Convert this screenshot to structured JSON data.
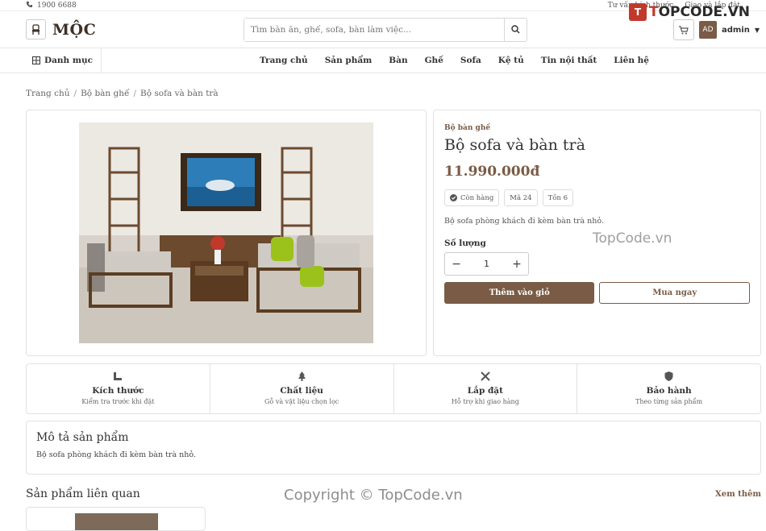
{
  "topbar": {
    "phone": "1900 6688",
    "links": [
      "Tư vấn kích thước",
      "Giao và lắp đặt"
    ]
  },
  "brand": {
    "name": "MỘC",
    "overlay_logo": "TOPCODE.VN"
  },
  "search": {
    "placeholder": "Tìm bàn ăn, ghế, sofa, bàn làm việc..."
  },
  "user": {
    "initials": "AD",
    "name": "admin"
  },
  "nav": {
    "category_label": "Danh mục",
    "items": [
      "Trang chủ",
      "Sản phẩm",
      "Bàn",
      "Ghế",
      "Sofa",
      "Kệ tủ",
      "Tin nội thất",
      "Liên hệ"
    ]
  },
  "breadcrumb": [
    "Trang chủ",
    "Bộ bàn ghế",
    "Bộ sofa và bàn trà"
  ],
  "product": {
    "category": "Bộ bàn ghế",
    "title": "Bộ sofa và bàn trà",
    "price": "11.990.000đ",
    "badges": [
      "Còn hàng",
      "Mã 24",
      "Tồn 6"
    ],
    "short_desc": "Bộ sofa phòng khách đi kèm bàn trà nhỏ.",
    "qty_label": "Số lượng",
    "qty": "1",
    "add_to_cart": "Thêm vào giỏ",
    "buy_now": "Mua ngay"
  },
  "features": [
    {
      "title": "Kích thước",
      "sub": "Kiểm tra trước khi đặt",
      "icon": "ruler-icon"
    },
    {
      "title": "Chất liệu",
      "sub": "Gỗ và vật liệu chọn lọc",
      "icon": "tree-icon"
    },
    {
      "title": "Lắp đặt",
      "sub": "Hỗ trợ khi giao hàng",
      "icon": "tools-icon"
    },
    {
      "title": "Bảo hành",
      "sub": "Theo từng sản phẩm",
      "icon": "shield-icon"
    }
  ],
  "description": {
    "heading": "Mô tả sản phẩm",
    "text": "Bộ sofa phòng khách đi kèm bàn trà nhỏ."
  },
  "related": {
    "heading": "Sản phẩm liên quan",
    "more": "Xem thêm"
  },
  "watermarks": {
    "center": "TopCode.vn",
    "footer": "Copyright © TopCode.vn"
  },
  "colors": {
    "accent": "#7a5b45",
    "brand_red": "#c0392b"
  }
}
